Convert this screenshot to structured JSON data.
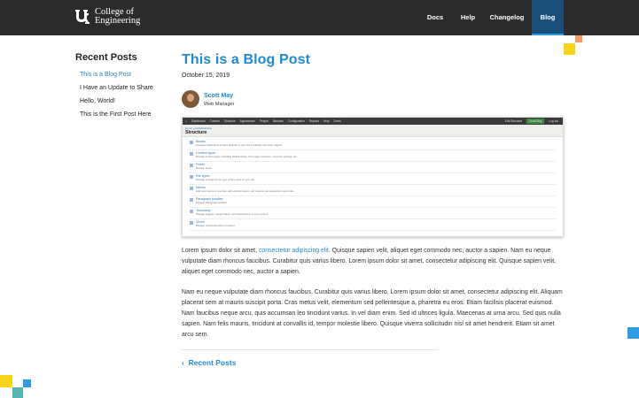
{
  "header": {
    "logo_line1": "College of",
    "logo_line2": "Engineering",
    "nav": [
      {
        "label": "Docs"
      },
      {
        "label": "Help"
      },
      {
        "label": "Changelog"
      },
      {
        "label": "Blog",
        "active": true
      }
    ]
  },
  "sidebar": {
    "title": "Recent Posts",
    "items": [
      {
        "label": "This is a Blog Post",
        "active": true
      },
      {
        "label": "I Have an Update to Share"
      },
      {
        "label": "Hello, World!"
      },
      {
        "label": "This is the First Post Here"
      }
    ]
  },
  "post": {
    "title": "This is a Blog Post",
    "date": "October 15, 2019",
    "author": {
      "name": "Scott May",
      "role": "Web Manager"
    },
    "paragraph1_before": "Lorem ipsum dolor sit amet, ",
    "paragraph1_link": "consectetur adipiscing elit",
    "paragraph1_after": ". Quisque sapien velit, aliquet eget commodo nec, auctor a sapien. Nam eu neque vulputate diam rhoncus faucibus. Curabitur quis varius libero. Lorem ipsum dolor sit amet, consectetur adipiscing elit. Quisque sapien velit, aliquet eget commodo nec, auctor a sapien.",
    "paragraph2": "Nam eu neque vulputate diam rhoncus faucibus. Curabitur quis varius libero. Lorem ipsum dolor sit amet, consectetur adipiscing elit. Aliquam placerat sem at mauris suscipit porta. Cras metus velit, elementum sed pellentesque a, pharetra eu eros. Etiam facilisis placerat euismod. Nam faucibus neque arcu, quis accumsan leo tincidunt varius. In vel diam enim. Sed id ultrices ligula. Maecenas at urna arcu. Sed quis nulla sapien. Nam felis mauris, tincidunt at convallis id, tempor molestie libero. Quisque viverra sollicitudin nisl sit amet hendrerit. Etiam sit amet arcu sem.",
    "back_link": "Recent Posts"
  },
  "embedded_screenshot": {
    "toolbar": [
      "Dashboard",
      "Content",
      "Structure",
      "Appearance",
      "People",
      "Modules",
      "Configuration",
      "Reports",
      "Help",
      "Devel"
    ],
    "right_buttons": [
      "Edit Structure",
      "Scott May",
      "Log out"
    ],
    "breadcrumb": "Home » Administration",
    "heading": "Structure",
    "rows": [
      {
        "title": "Blocks",
        "desc": "Configure what block content appears in your site's sidebars and other regions."
      },
      {
        "title": "Content types",
        "desc": "Manage content types, including default status, front page promotion, comment settings, etc."
      },
      {
        "title": "Feeds",
        "desc": "Manage feeds."
      },
      {
        "title": "File types",
        "desc": "Manage settings for the type of files used on your site."
      },
      {
        "title": "Menus",
        "desc": "Add new menus to your site, edit existing menus, and rename and reorganize menu links."
      },
      {
        "title": "Paragraph bundles",
        "desc": "Manage Paragraph bundles."
      },
      {
        "title": "Taxonomy",
        "desc": "Manage tagging, categorization, and classification of your content."
      },
      {
        "title": "Views",
        "desc": "Manage customized lists of content."
      }
    ]
  },
  "colors": {
    "accent": "#1f8ad2",
    "topbar": "#2b2b2b",
    "active_nav": "#1a4f7a",
    "deco_orange": "#f39a6a",
    "deco_yellow": "#f7d417",
    "deco_blue": "#2e9be6",
    "deco_teal": "#53b6b3"
  }
}
